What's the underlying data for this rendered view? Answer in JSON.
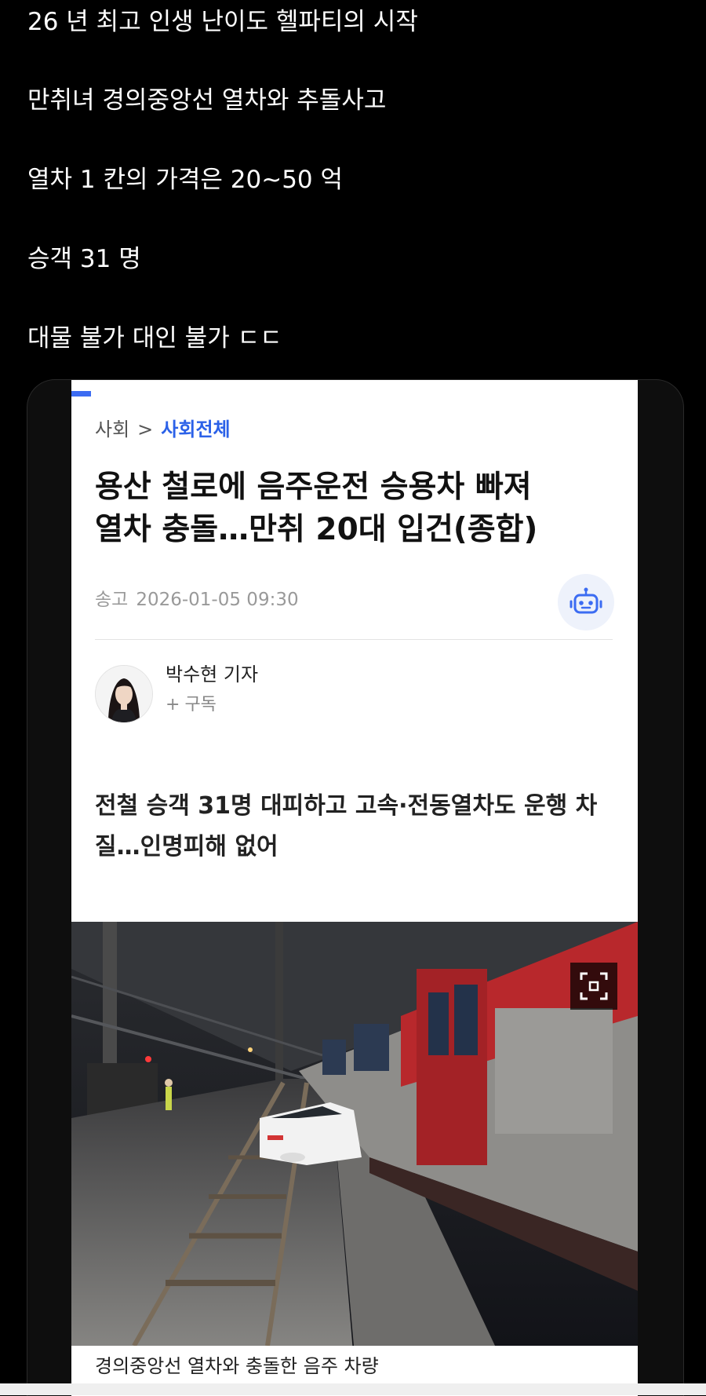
{
  "post": {
    "lines": [
      "26 년 최고 인생 난이도 헬파티의 시작",
      "만취녀 경의중앙선 열차와 추돌사고",
      "열차 1 칸의 가격은 20~50 억",
      "승객 31 명",
      "대물 불가 대인 불가 ㄷㄷ"
    ]
  },
  "article": {
    "breadcrumb": {
      "section": "사회",
      "separator": ">",
      "current": "사회전체"
    },
    "headline_lines": [
      "용산 철로에 음주운전 승용차 빠져",
      "열차 충돌…만취 20대 입건(종합)"
    ],
    "send_label": "송고",
    "send_time": "2026-01-05 09:30",
    "author": {
      "name": "박수현 기자",
      "subscribe_plus": "+",
      "subscribe_label": "구독"
    },
    "subtitle_lines": [
      "전철 승객 31명 대피하고 고속·전동열차도 운행 차",
      "질…인명피해 없어"
    ],
    "photo_caption": "경의중앙선 열차와 충돌한 음주 차량"
  },
  "icons": {
    "robot": "robot-icon",
    "expand": "expand-icon",
    "breadcrumb_separator": "chevron-right-icon"
  },
  "colors": {
    "background": "#000000",
    "accent": "#2b61e8",
    "train_red": "#b8282c",
    "car_white": "#f2f2f2"
  }
}
